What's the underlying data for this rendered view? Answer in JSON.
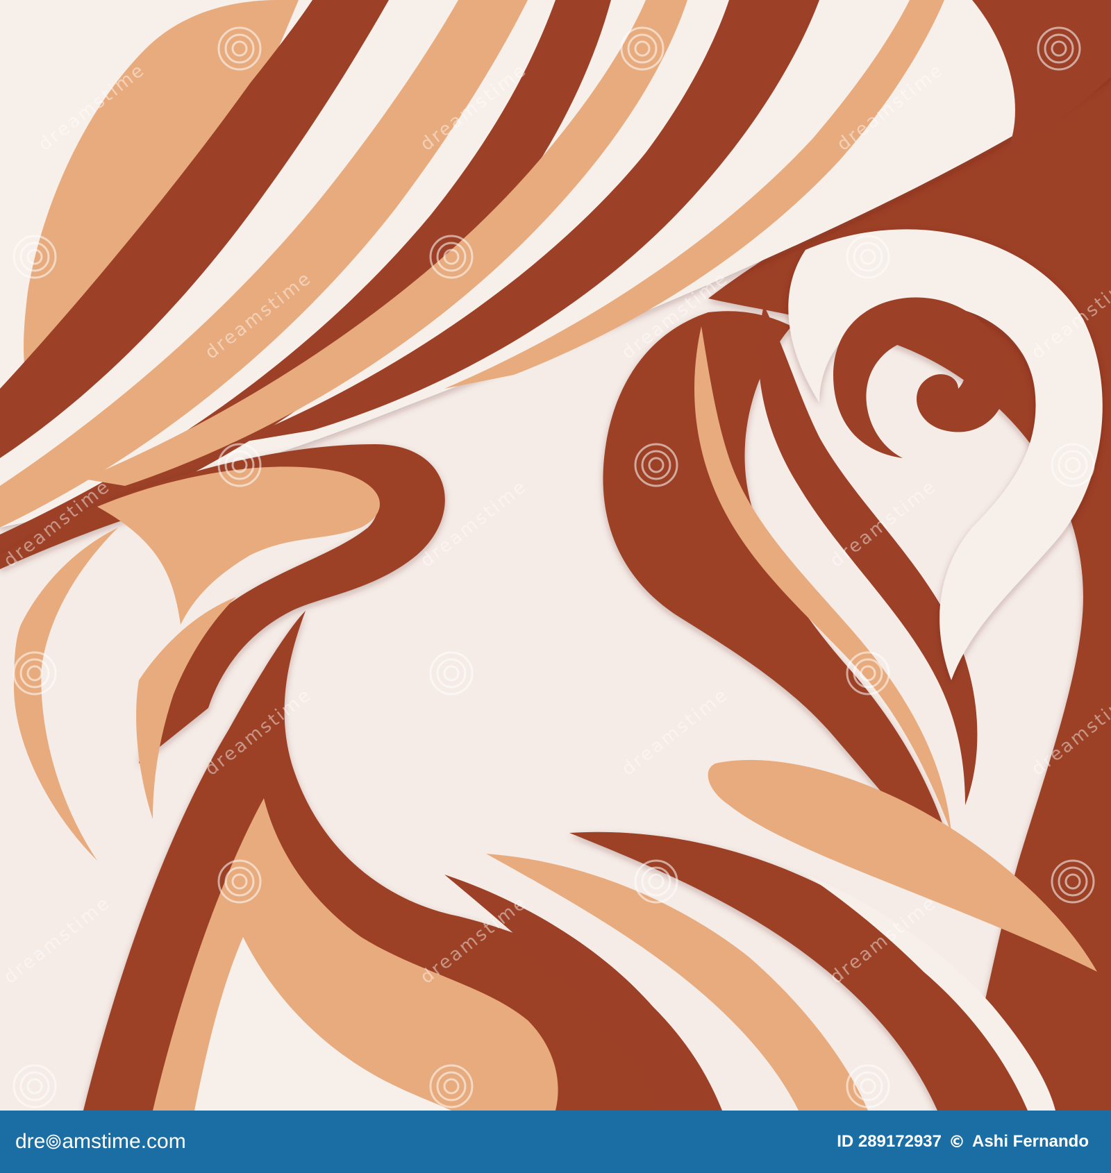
{
  "image": {
    "description": "",
    "colors": {
      "background": "#f5ece7",
      "rust": "#9c4128",
      "tan": "#e8ab7e",
      "cream": "#f7efea",
      "footer": "#1b6ea3"
    }
  },
  "watermark": {
    "text": "dreamstime",
    "icon": "spiral-logo-icon"
  },
  "footer": {
    "brand_prefix": "dre",
    "brand_suffix": "amstime.com",
    "brand_icon": "spiral-logo-icon",
    "image_id": "ID 289172937",
    "copyright_icon": "copyright-icon",
    "copyright_symbol": "©",
    "author": "Ashi Fernando"
  }
}
